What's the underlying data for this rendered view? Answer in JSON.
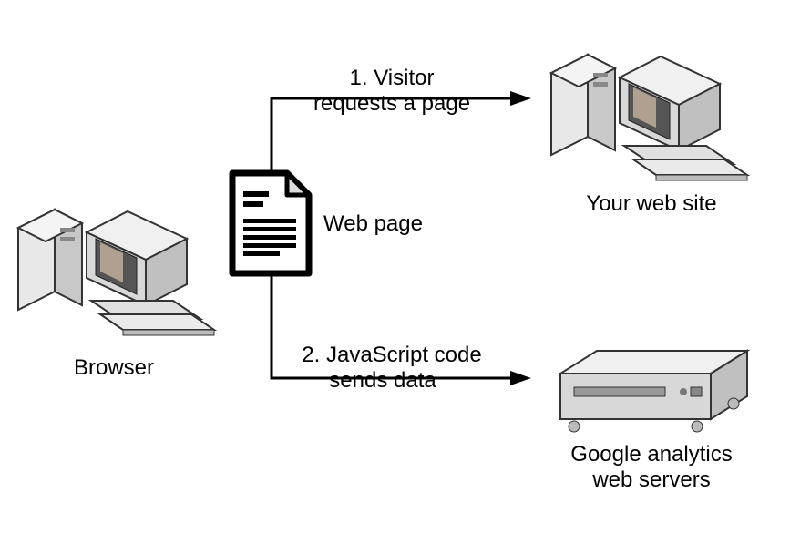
{
  "diagram": {
    "browser_label": "Browser",
    "webpage_label": "Web page",
    "website_label": "Your web site",
    "servers_label_line1": "Google analytics",
    "servers_label_line2": "web servers",
    "step1_text1": "1. Visitor",
    "step1_text2": "requests a page",
    "step2_text1": "2. JavaScript code",
    "step2_text2": "sends data"
  }
}
